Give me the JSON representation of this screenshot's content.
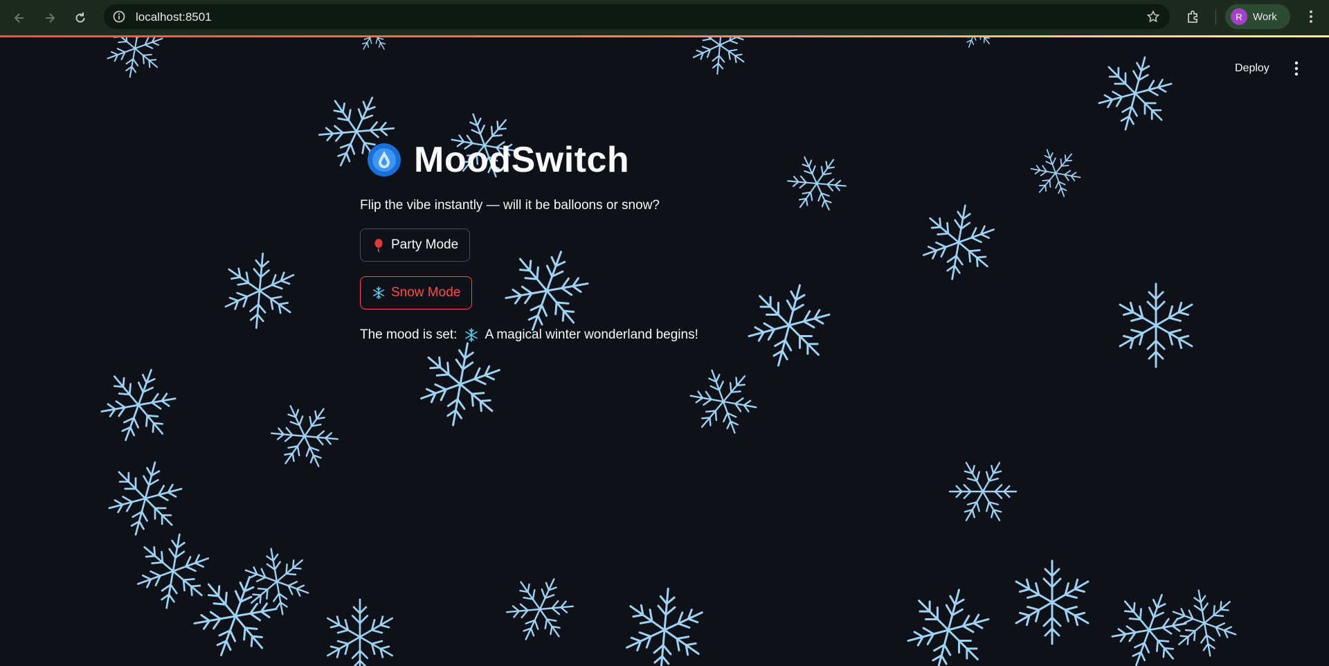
{
  "browser": {
    "url": "localhost:8501",
    "profile_initial": "R",
    "profile_name": "Work"
  },
  "header": {
    "deploy_label": "Deploy"
  },
  "app": {
    "title": "MoodSwitch",
    "subtitle": "Flip the vibe instantly — will it be balloons or snow?",
    "party_button_label": "Party Mode",
    "snow_button_label": "Snow Mode",
    "status_prefix": "The mood is set:",
    "status_message": "A magical winter wonderland begins!"
  },
  "colors": {
    "background": "#0e1117",
    "text": "#fafafa",
    "active_accent": "#ff4b4b",
    "snowflake": "#9fd3f5",
    "chrome": "#1d2b1f"
  },
  "icons": {
    "title_icon": "swirl-drop-icon",
    "party_icon": "balloon-icon",
    "snow_icon": "snowflake-icon"
  }
}
